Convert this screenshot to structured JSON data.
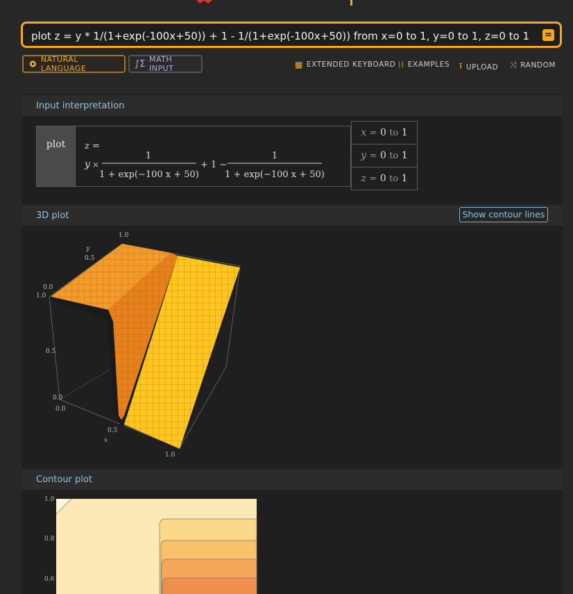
{
  "search": {
    "query": "plot z = y * 1/(1+exp(-100x+50)) + 1 - 1/(1+exp(-100x+50)) from x=0 to 1, y=0 to 1, z=0 to 1"
  },
  "modes": {
    "natural_language": "NATURAL LANGUAGE",
    "math_input": "MATH INPUT"
  },
  "tools": {
    "keyboard": "EXTENDED KEYBOARD",
    "examples": "EXAMPLES",
    "upload": "UPLOAD",
    "random": "RANDOM"
  },
  "pods": {
    "interpretation": {
      "title": "Input interpretation",
      "plot_label": "plot",
      "formula": {
        "lhs": "z =",
        "y": "y",
        "times": "×",
        "num": "1",
        "den": "1 + exp(−100 x + 50)",
        "plus_one_minus": "+ 1 −"
      },
      "ranges": [
        {
          "var": "x",
          "eq": "=",
          "from": "0",
          "to_word": "to",
          "to": "1"
        },
        {
          "var": "y",
          "eq": "=",
          "from": "0",
          "to_word": "to",
          "to": "1"
        },
        {
          "var": "z",
          "eq": "=",
          "from": "0",
          "to_word": "to",
          "to": "1"
        }
      ]
    },
    "plot3d": {
      "title": "3D plot",
      "contour_button": "Show contour lines",
      "axis_labels": {
        "z_top": "1.0",
        "y_label": "y",
        "y_mid": "0.5",
        "y_zero": "0.0",
        "z_one": "1.0",
        "z_mid": "0.5",
        "z_zero": "0.0",
        "x_zero": "0.0",
        "x_mid": "0.5",
        "x_label": "x",
        "x_one": "1.0"
      }
    },
    "contour": {
      "title": "Contour plot",
      "y_ticks": [
        "1.0",
        "0.8",
        "0.6"
      ]
    }
  },
  "colors": {
    "accent": "#f5a623",
    "link": "#8fc3e0",
    "surface_top": "#f39a2a",
    "surface_front": "#ffc520"
  }
}
